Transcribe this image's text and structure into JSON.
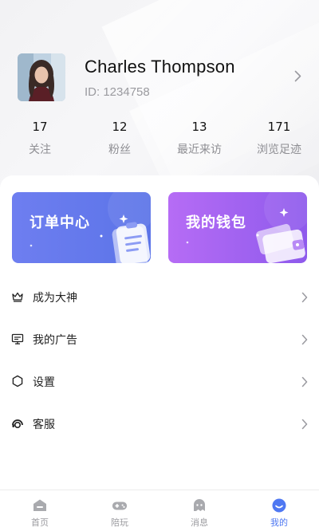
{
  "profile": {
    "name": "Charles Thompson",
    "id_text": "ID: 1234758"
  },
  "stats": [
    {
      "value": "17",
      "label": "关注"
    },
    {
      "value": "12",
      "label": "粉丝"
    },
    {
      "value": "13",
      "label": "最近来访"
    },
    {
      "value": "171",
      "label": "浏览足迹"
    }
  ],
  "banners": {
    "order": {
      "title": "订单中心",
      "color": "#6e7ef0"
    },
    "wallet": {
      "title": "我的钱包",
      "color": "#a463f2"
    }
  },
  "menu": [
    {
      "label": "成为大神",
      "icon": "crown-icon"
    },
    {
      "label": "我的广告",
      "icon": "ad-board-icon"
    },
    {
      "label": "设置",
      "icon": "hexagon-settings-icon"
    },
    {
      "label": "客服",
      "icon": "headset-icon"
    }
  ],
  "tabbar": [
    {
      "label": "首页",
      "icon": "home-icon"
    },
    {
      "label": "陪玩",
      "icon": "gamepad-icon"
    },
    {
      "label": "消息",
      "icon": "message-ghost-icon"
    },
    {
      "label": "我的",
      "icon": "profile-smile-icon",
      "active": true
    }
  ],
  "colors": {
    "accent": "#4f78f2",
    "text_secondary": "#8e8e93"
  }
}
